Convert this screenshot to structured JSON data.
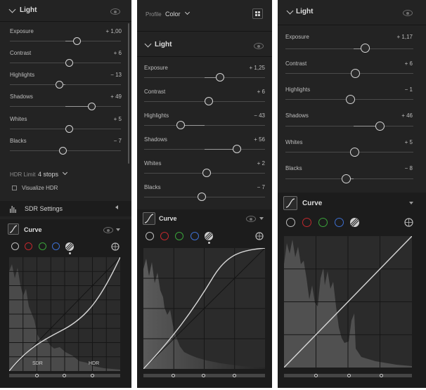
{
  "panel1": {
    "light_title": "Light",
    "sliders": [
      {
        "label": "Exposure",
        "value": "+ 1,00"
      },
      {
        "label": "Contrast",
        "value": "+ 6"
      },
      {
        "label": "Highlights",
        "value": "− 13"
      },
      {
        "label": "Shadows",
        "value": "+ 49"
      },
      {
        "label": "Whites",
        "value": "+ 5"
      },
      {
        "label": "Blacks",
        "value": "− 7"
      }
    ],
    "hdr_limit_label": "HDR Limit",
    "hdr_limit_value": "4 stops",
    "visualize_hdr_label": "Visualize HDR",
    "sdr_settings_label": "SDR Settings",
    "curve_title": "Curve",
    "sdr_marker": "SDR",
    "hdr_marker": "HDR"
  },
  "panel2": {
    "profile_label": "Profile",
    "profile_value": "Color",
    "light_title": "Light",
    "sliders": [
      {
        "label": "Exposure",
        "value": "+ 1,25"
      },
      {
        "label": "Contrast",
        "value": "+ 6"
      },
      {
        "label": "Highlights",
        "value": "− 43"
      },
      {
        "label": "Shadows",
        "value": "+ 56"
      },
      {
        "label": "Whites",
        "value": "+ 2"
      },
      {
        "label": "Blacks",
        "value": "− 7"
      }
    ],
    "curve_title": "Curve"
  },
  "panel3": {
    "light_title": "Light",
    "sliders": [
      {
        "label": "Exposure",
        "value": "+ 1,17"
      },
      {
        "label": "Contrast",
        "value": "+ 6"
      },
      {
        "label": "Highlights",
        "value": "− 1"
      },
      {
        "label": "Shadows",
        "value": "+ 46"
      },
      {
        "label": "Whites",
        "value": "+ 5"
      },
      {
        "label": "Blacks",
        "value": "− 8"
      }
    ],
    "curve_title": "Curve"
  },
  "colors": {
    "panel_bg": "#232323",
    "text": "#bdbdbd",
    "red": "#c0282d",
    "green": "#3aa33a",
    "blue": "#3d6fd0"
  }
}
